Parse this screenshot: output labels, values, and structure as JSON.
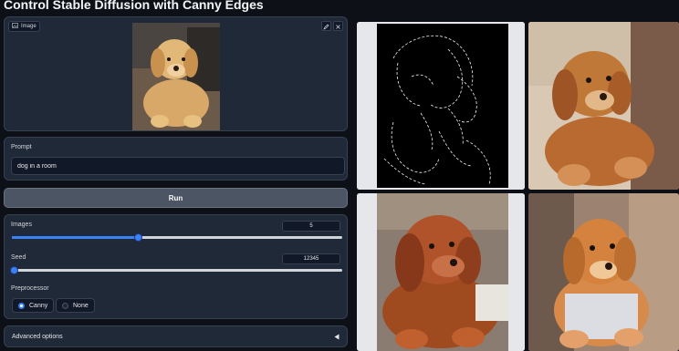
{
  "app": {
    "title": "Control Stable Diffusion with Canny Edges"
  },
  "image_input": {
    "tag_label": "Image"
  },
  "prompt": {
    "label": "Prompt",
    "value": "dog in a room"
  },
  "run": {
    "label": "Run"
  },
  "images_control": {
    "label": "Images",
    "value": "5",
    "fraction": 0.38
  },
  "seed_control": {
    "label": "Seed",
    "value": "12345",
    "fraction": 0.005
  },
  "preprocessor": {
    "label": "Preprocessor",
    "options": [
      "Canny",
      "None"
    ],
    "selected": "Canny"
  },
  "advanced": {
    "label": "Advanced options"
  }
}
